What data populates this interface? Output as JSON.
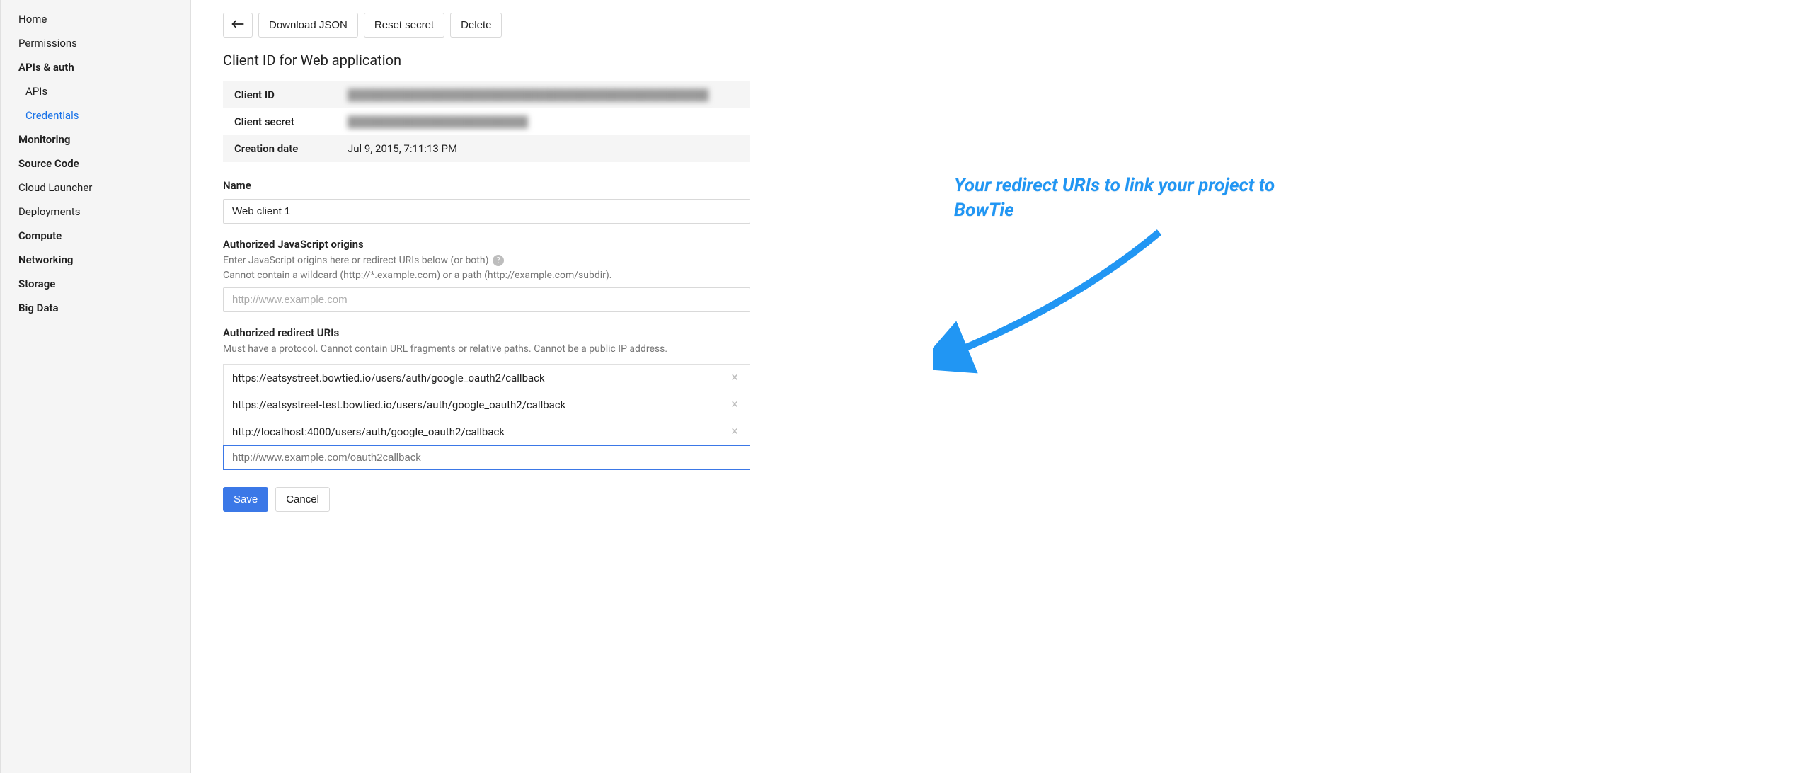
{
  "sidebar": {
    "items": [
      {
        "label": "Home",
        "bold": false,
        "sub": false,
        "active": false
      },
      {
        "label": "Permissions",
        "bold": false,
        "sub": false,
        "active": false
      },
      {
        "label": "APIs & auth",
        "bold": true,
        "sub": false,
        "active": false
      },
      {
        "label": "APIs",
        "bold": false,
        "sub": true,
        "active": false
      },
      {
        "label": "Credentials",
        "bold": false,
        "sub": true,
        "active": true
      },
      {
        "label": "Monitoring",
        "bold": true,
        "sub": false,
        "active": false
      },
      {
        "label": "Source Code",
        "bold": true,
        "sub": false,
        "active": false
      },
      {
        "label": "Cloud Launcher",
        "bold": false,
        "sub": false,
        "active": false
      },
      {
        "label": "Deployments",
        "bold": false,
        "sub": false,
        "active": false
      },
      {
        "label": "Compute",
        "bold": true,
        "sub": false,
        "active": false
      },
      {
        "label": "Networking",
        "bold": true,
        "sub": false,
        "active": false
      },
      {
        "label": "Storage",
        "bold": true,
        "sub": false,
        "active": false
      },
      {
        "label": "Big Data",
        "bold": true,
        "sub": false,
        "active": false
      }
    ]
  },
  "toolbar": {
    "download_json": "Download JSON",
    "reset_secret": "Reset secret",
    "delete": "Delete"
  },
  "page_title": "Client ID for Web application",
  "info": {
    "client_id_label": "Client ID",
    "client_id_value": "████████████████████████████████████████████████",
    "client_secret_label": "Client secret",
    "client_secret_value": "████████████████████████",
    "creation_date_label": "Creation date",
    "creation_date_value": "Jul 9, 2015, 7:11:13 PM"
  },
  "name": {
    "label": "Name",
    "value": "Web client 1"
  },
  "js_origins": {
    "label": "Authorized JavaScript origins",
    "help1": "Enter JavaScript origins here or redirect URIs below (or both)",
    "help2": "Cannot contain a wildcard (http://*.example.com) or a path (http://example.com/subdir).",
    "placeholder": "http://www.example.com"
  },
  "redirect_uris": {
    "label": "Authorized redirect URIs",
    "help": "Must have a protocol. Cannot contain URL fragments or relative paths. Cannot be a public IP address.",
    "items": [
      "https://eatsystreet.bowtied.io/users/auth/google_oauth2/callback",
      "https://eatsystreet-test.bowtied.io/users/auth/google_oauth2/callback",
      "http://localhost:4000/users/auth/google_oauth2/callback"
    ],
    "placeholder": "http://www.example.com/oauth2callback"
  },
  "actions": {
    "save": "Save",
    "cancel": "Cancel"
  },
  "annotation": {
    "text": "Your redirect URIs to link your project to BowTie"
  }
}
